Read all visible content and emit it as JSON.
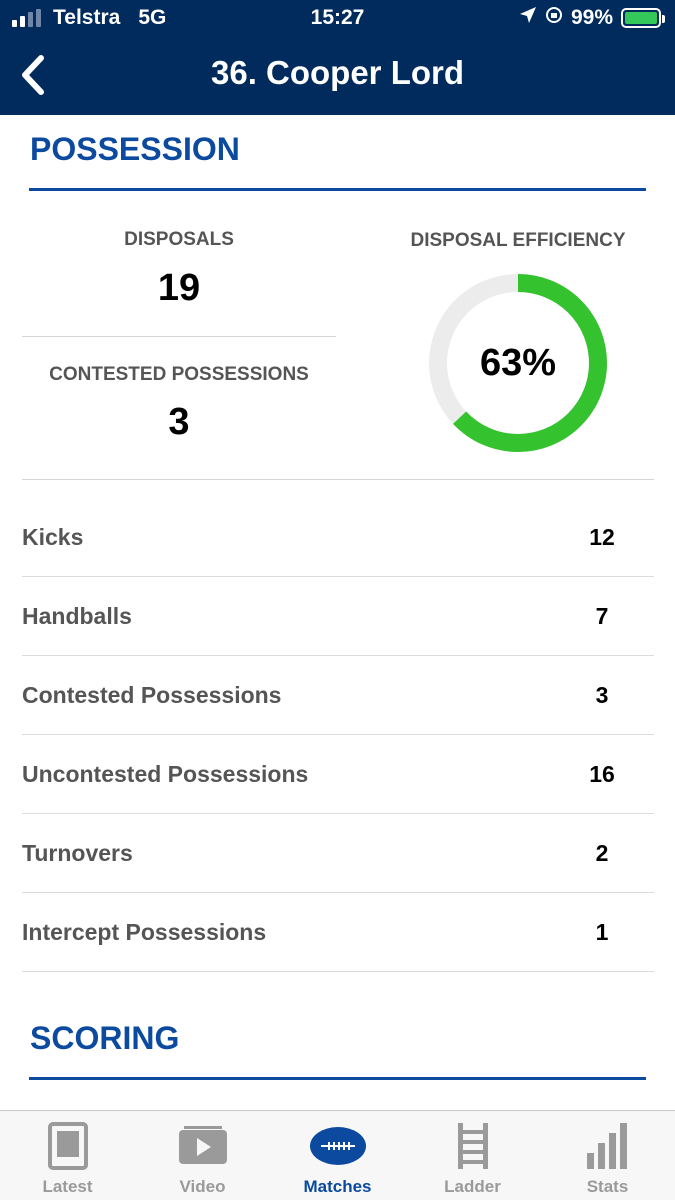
{
  "status_bar": {
    "carrier": "Telstra",
    "network": "5G",
    "time": "15:27",
    "battery": "99%"
  },
  "nav": {
    "title": "36. Cooper Lord"
  },
  "possession": {
    "heading": "POSSESSION",
    "disposals_label": "DISPOSALS",
    "disposals_value": "19",
    "contested_label": "CONTESTED POSSESSIONS",
    "contested_value": "3",
    "efficiency_label": "DISPOSAL EFFICIENCY",
    "efficiency_text": "63%",
    "efficiency_fraction": 0.63,
    "rows": [
      {
        "label": "Kicks",
        "value": "12"
      },
      {
        "label": "Handballs",
        "value": "7"
      },
      {
        "label": "Contested Possessions",
        "value": "3"
      },
      {
        "label": "Uncontested Possessions",
        "value": "16"
      },
      {
        "label": "Turnovers",
        "value": "2"
      },
      {
        "label": "Intercept Possessions",
        "value": "1"
      }
    ]
  },
  "scoring": {
    "heading": "SCORING"
  },
  "tabs": [
    {
      "label": "Latest",
      "icon": "news-icon",
      "active": false
    },
    {
      "label": "Video",
      "icon": "play-icon",
      "active": false
    },
    {
      "label": "Matches",
      "icon": "football-icon",
      "active": true
    },
    {
      "label": "Ladder",
      "icon": "ladder-icon",
      "active": false
    },
    {
      "label": "Stats",
      "icon": "bar-chart-icon",
      "active": false
    }
  ],
  "colors": {
    "header_bg": "#002b5c",
    "accent": "#0b4a9e",
    "efficiency_ring": "#34c22f",
    "ring_track": "#ececec"
  }
}
